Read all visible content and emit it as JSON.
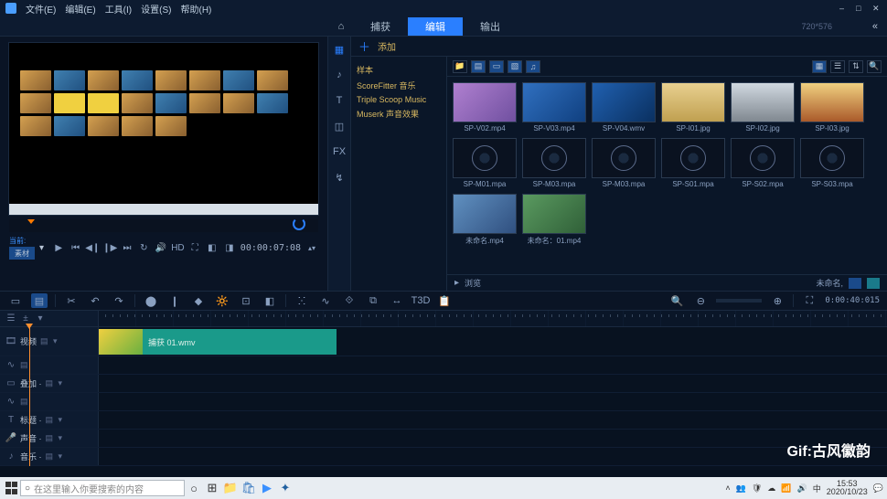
{
  "menu": {
    "file": "文件(E)",
    "edit": "编辑(E)",
    "tools": "工具(I)",
    "settings": "设置(S)",
    "help": "帮助(H)"
  },
  "dim_label": "720*576",
  "tabs": {
    "capture": "捕获",
    "edit": "编辑",
    "output": "输出"
  },
  "transport": {
    "current_label": "当前:",
    "source_label": "素材",
    "hd": "HD",
    "timecode": "00:00:07:08"
  },
  "lib": {
    "add": "添加",
    "side": {
      "fx": "样本",
      "scorefitter": "ScoreFitter 音乐",
      "triple": "Triple Scoop Music",
      "muserk": "Muserk 声音效果"
    },
    "footer_browse": "浏览",
    "footer_file": "未命名,"
  },
  "assets": {
    "v02": "SP-V02.mp4",
    "v03": "SP-V03.mp4",
    "v04": "SP-V04.wmv",
    "i01": "SP-I01.jpg",
    "i02": "SP-I02.jpg",
    "i03": "SP-I03.jpg",
    "m01": "SP-M01.mpa",
    "m03": "SP-M03.mpa",
    "m03b": "SP-M03.mpa",
    "s01": "SP-S01.mpa",
    "s02": "SP-S02.mpa",
    "s03": "SP-S03.mpa",
    "cap1": "未命名.mp4",
    "cap2": "未命名：01.mp4"
  },
  "toolbar": {
    "t3d": "T3D",
    "timecode": "0:00:40:015"
  },
  "tracks": {
    "video": "视频",
    "overlay": "叠加 ·",
    "title": "标题 ·",
    "audio": "声音 ·",
    "music": "音乐 ·"
  },
  "clip": {
    "name": "捕获 01.wmv"
  },
  "watermark": "Gif:古风徽韵",
  "taskbar": {
    "search_placeholder": "在这里输入你要搜索的内容",
    "ime": "中",
    "time": "15:53",
    "date": "2020/10/23"
  }
}
